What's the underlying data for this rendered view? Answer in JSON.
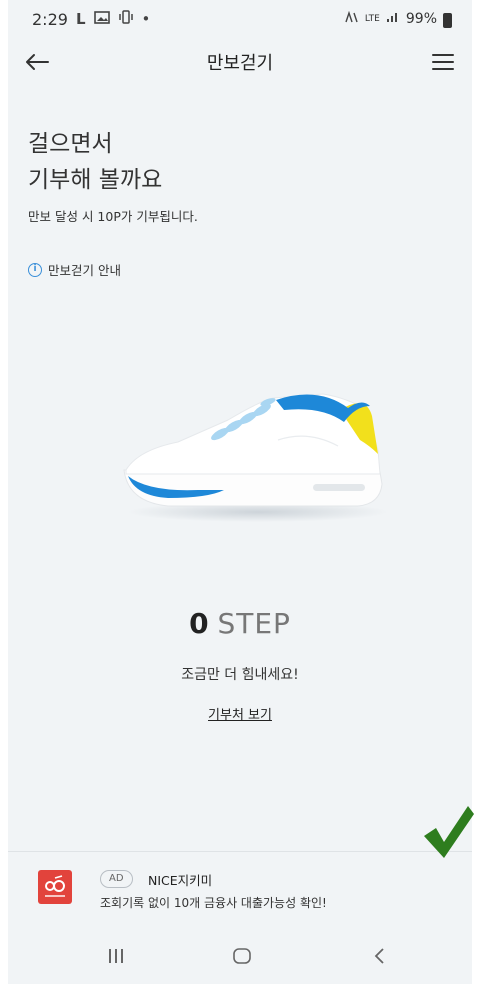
{
  "status_bar": {
    "time": "2:29",
    "left_icons": [
      "L",
      "image-icon",
      "vibrate-icon",
      "•"
    ],
    "network": "LTE",
    "battery": "99%"
  },
  "app_bar": {
    "title": "만보걷기",
    "back_icon": "arrow-left-icon",
    "menu_icon": "hamburger-menu-icon"
  },
  "main": {
    "heading_line1": "걸으면서",
    "heading_line2": "기부해 볼까요",
    "subtext": "만보 달성 시 10P가 기부됩니다.",
    "info_link": "만보걷기 안내",
    "step_count": "0",
    "step_unit": "STEP",
    "cheer": "조금만 더 힘내세요!",
    "donation_link": "기부처 보기"
  },
  "ad": {
    "badge": "AD",
    "title": "NICE지키미",
    "description": "조회기록 없이 10개 금융사 대출가능성 확인!"
  },
  "nav": {
    "recent_icon": "recent-apps-icon",
    "home_icon": "home-icon",
    "back_icon": "back-chevron-icon"
  },
  "colors": {
    "background": "#f1f4f6",
    "shoe_blue": "#1e88d8",
    "shoe_yellow": "#f2e01c",
    "ad_logo": "#e2433c",
    "checkmark": "#2e7d1e"
  }
}
